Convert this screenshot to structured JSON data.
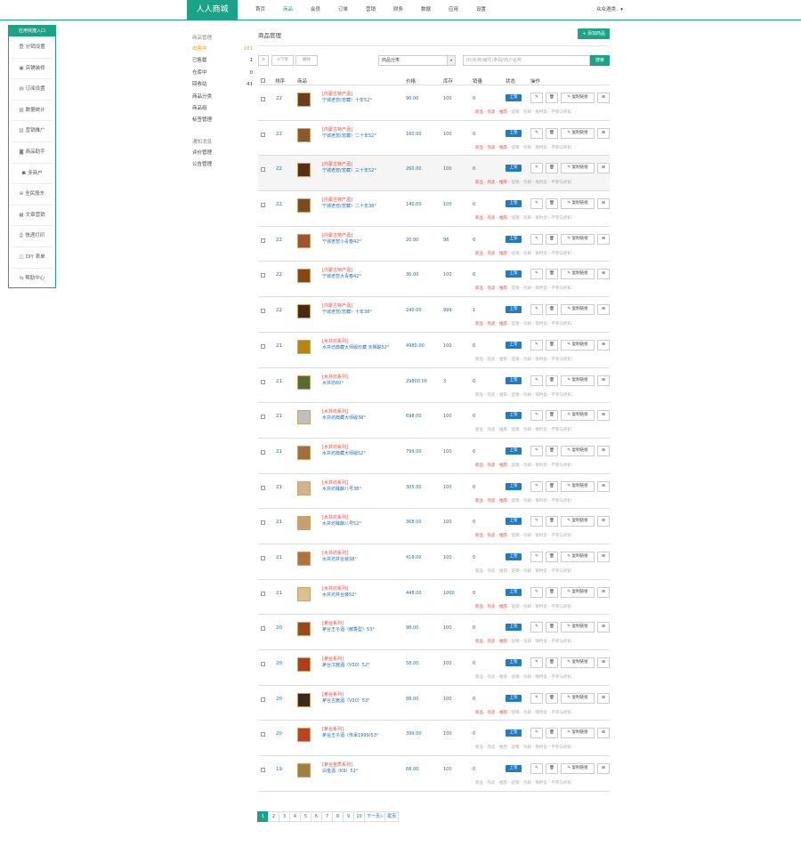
{
  "brand": "人人商城",
  "topnav": [
    "首页",
    "商品",
    "会员",
    "订单",
    "营销",
    "财务",
    "数据",
    "应用",
    "设置"
  ],
  "topnav_active": 1,
  "user_label": "众众酒类..",
  "side_card": {
    "header": "应用快捷入口",
    "items": [
      {
        "icon": "豐",
        "label": "分销设置"
      },
      {
        "icon": "▣",
        "label": "店铺装修"
      },
      {
        "icon": "▤",
        "label": "订阅设置"
      },
      {
        "icon": "▧",
        "label": "数据统计"
      },
      {
        "icon": "▥",
        "label": "营销推广"
      },
      {
        "icon": "◙",
        "label": "商品助手"
      },
      {
        "icon": "☗",
        "label": "多商户"
      },
      {
        "icon": "⊕",
        "label": "全民股东"
      },
      {
        "icon": "▦",
        "label": "文章营销"
      },
      {
        "icon": "⎙",
        "label": "快递打印"
      },
      {
        "icon": "◫",
        "label": "DIY 表单"
      },
      {
        "icon": "⇆",
        "label": "帮助中心"
      }
    ]
  },
  "subnav": {
    "header1": "商品管理",
    "items1": [
      {
        "label": "出售中",
        "count": "181",
        "active": true
      },
      {
        "label": "已售罄",
        "count": "1",
        "active": false
      },
      {
        "label": "仓库中",
        "count": "0",
        "active": false
      },
      {
        "label": "回收站",
        "count": "41",
        "active": false
      },
      {
        "label": "商品分类",
        "count": "",
        "active": false
      },
      {
        "label": "商品组",
        "count": "",
        "active": false
      },
      {
        "label": "标签管理",
        "count": "",
        "active": false
      }
    ],
    "header2": "通知消息",
    "items2": [
      {
        "label": "评价管理"
      },
      {
        "label": "公告管理"
      }
    ]
  },
  "page_title": "商品管理",
  "add_button": "+ 添加商品",
  "toolbar": {
    "refresh": "⟳",
    "btn_down": "⊘下架",
    "btn_del": "删除",
    "category_select": "商品分类",
    "search_placeholder": "ID/名称/编号/条码/商户名称",
    "search_button": "搜索"
  },
  "table_headers": [
    "排序",
    "商品",
    "价格",
    "库存",
    "销量",
    "状态",
    "操作"
  ],
  "row_actions": {
    "status": "上架",
    "edit": "✎",
    "delete": "🗑",
    "copy": "✎ 复制链接",
    "qr": "⊞"
  },
  "tag_labels": [
    "新品",
    "热卖",
    "推荐",
    "促销",
    "包邮",
    "限时卖",
    "不参与折扣"
  ],
  "rows": [
    {
      "order": "22",
      "cat": "[内蒙古特产酒]",
      "name": "宁城老窖(窖藏）十年52°",
      "price": "90.00",
      "stock": "100",
      "sales": "0",
      "tags_on": [
        true,
        true,
        true,
        false,
        false,
        false,
        false
      ],
      "hl": false
    },
    {
      "order": "22",
      "cat": "[内蒙古特产酒]",
      "name": "宁城老窖(窖藏）二十年52°",
      "price": "160.00",
      "stock": "100",
      "sales": "0",
      "tags_on": [
        true,
        true,
        true,
        false,
        false,
        false,
        false
      ],
      "hl": false
    },
    {
      "order": "22",
      "cat": "[内蒙古特产酒]",
      "name": "宁城老窖(窖藏）三十年52°",
      "price": "260.00",
      "stock": "100",
      "sales": "0",
      "tags_on": [
        true,
        true,
        true,
        false,
        false,
        false,
        false
      ],
      "hl": true
    },
    {
      "order": "22",
      "cat": "[内蒙古特产酒]",
      "name": "宁城老窖(窖藏）二十年38°",
      "price": "140.00",
      "stock": "100",
      "sales": "0",
      "tags_on": [
        true,
        true,
        true,
        false,
        false,
        false,
        false
      ],
      "hl": false
    },
    {
      "order": "22",
      "cat": "[内蒙古特产酒]",
      "name": "宁城老窖小青春42°",
      "price": "20.00",
      "stock": "98",
      "sales": "0",
      "tags_on": [
        true,
        true,
        true,
        false,
        false,
        false,
        false
      ],
      "hl": false
    },
    {
      "order": "22",
      "cat": "[内蒙古特产酒]",
      "name": "宁城老窖大青春42°",
      "price": "30.00",
      "stock": "100",
      "sales": "0",
      "tags_on": [
        true,
        true,
        true,
        false,
        false,
        false,
        false
      ],
      "hl": false
    },
    {
      "order": "22",
      "cat": "[内蒙古特产酒]",
      "name": "宁城老窖(窖藏）十年38°",
      "price": "240.00",
      "stock": "999",
      "sales": "1",
      "tags_on": [
        true,
        true,
        true,
        false,
        false,
        false,
        false
      ],
      "hl": false
    },
    {
      "order": "21",
      "cat": "[水井坊系列]",
      "name": "水井坊典藏大师版珍藏 天赐酩52°",
      "price": "4980.00",
      "stock": "100",
      "sales": "0",
      "tags_on": [
        false,
        false,
        false,
        false,
        false,
        false,
        false
      ],
      "hl": false
    },
    {
      "order": "21",
      "cat": "[水井坊系列]",
      "name": "水井坊60°",
      "price": "29800.00",
      "stock": "3",
      "sales": "0",
      "tags_on": [
        false,
        false,
        false,
        false,
        false,
        false,
        false
      ],
      "hl": false
    },
    {
      "order": "21",
      "cat": "[水井坊系列]",
      "name": "水井坊典藏大师版38°",
      "price": "698.00",
      "stock": "100",
      "sales": "0",
      "tags_on": [
        false,
        false,
        false,
        false,
        false,
        false,
        false
      ],
      "hl": false
    },
    {
      "order": "21",
      "cat": "[水井坊系列]",
      "name": "水井坊典藏大师版52°",
      "price": "799.00",
      "stock": "100",
      "sales": "0",
      "tags_on": [
        true,
        true,
        true,
        false,
        false,
        false,
        false
      ],
      "hl": false
    },
    {
      "order": "21",
      "cat": "[水井坊系列]",
      "name": "水井坊臻酿八号38°",
      "price": "305.00",
      "stock": "100",
      "sales": "0",
      "tags_on": [
        true,
        true,
        true,
        false,
        false,
        false,
        false
      ],
      "hl": false
    },
    {
      "order": "21",
      "cat": "[水井坊系列]",
      "name": "水井坊臻酿八号52°",
      "price": "368.00",
      "stock": "100",
      "sales": "0",
      "tags_on": [
        true,
        true,
        true,
        false,
        false,
        false,
        false
      ],
      "hl": false
    },
    {
      "order": "21",
      "cat": "[水井坊系列]",
      "name": "水井坊井台装38°",
      "price": "418.00",
      "stock": "100",
      "sales": "0",
      "tags_on": [
        false,
        false,
        false,
        false,
        false,
        false,
        false
      ],
      "hl": false
    },
    {
      "order": "21",
      "cat": "[水井坊系列]",
      "name": "水井坊井台装52°",
      "price": "448.00",
      "stock": "1000",
      "sales": "0",
      "tags_on": [
        true,
        true,
        true,
        false,
        false,
        false,
        false
      ],
      "hl": false
    },
    {
      "order": "20",
      "cat": "[茅台系列]",
      "name": "茅台王子酒（酱香型）53°",
      "price": "98.00",
      "stock": "100",
      "sales": "0",
      "tags_on": [
        true,
        true,
        true,
        false,
        false,
        false,
        false
      ],
      "hl": false
    },
    {
      "order": "20",
      "cat": "[茅台系列]",
      "name": "茅台汉酱酒（V30）52°",
      "price": "58.00",
      "stock": "100",
      "sales": "0",
      "tags_on": [
        false,
        false,
        false,
        false,
        false,
        false,
        false
      ],
      "hl": false
    },
    {
      "order": "20",
      "cat": "[茅台系列]",
      "name": "茅台古酱酒（V30）53°",
      "price": "88.00",
      "stock": "100",
      "sales": "0",
      "tags_on": [
        true,
        true,
        true,
        false,
        false,
        false,
        false
      ],
      "hl": false
    },
    {
      "order": "20",
      "cat": "[茅台系列]",
      "name": "茅台王子酒（传承1999)53°",
      "price": "399.00",
      "stock": "100",
      "sales": "0",
      "tags_on": [
        false,
        false,
        false,
        false,
        false,
        false,
        false
      ],
      "hl": false
    },
    {
      "order": "19",
      "cat": "[茅台金质系列]",
      "name": "白金酒（K9）52°",
      "price": "68.00",
      "stock": "100",
      "sales": "0",
      "tags_on": [
        false,
        false,
        false,
        false,
        false,
        false,
        false
      ],
      "hl": false
    }
  ],
  "pager": [
    "1",
    "2",
    "3",
    "4",
    "5",
    "6",
    "7",
    "8",
    "9",
    "10",
    "下一页»",
    "尾页"
  ],
  "colors": {
    "brand": "#1aa386",
    "link": "#1f6fb5",
    "tag_on": "#e74c3c",
    "badge": "#1f7bc4",
    "active_sub": "#f39c12"
  }
}
